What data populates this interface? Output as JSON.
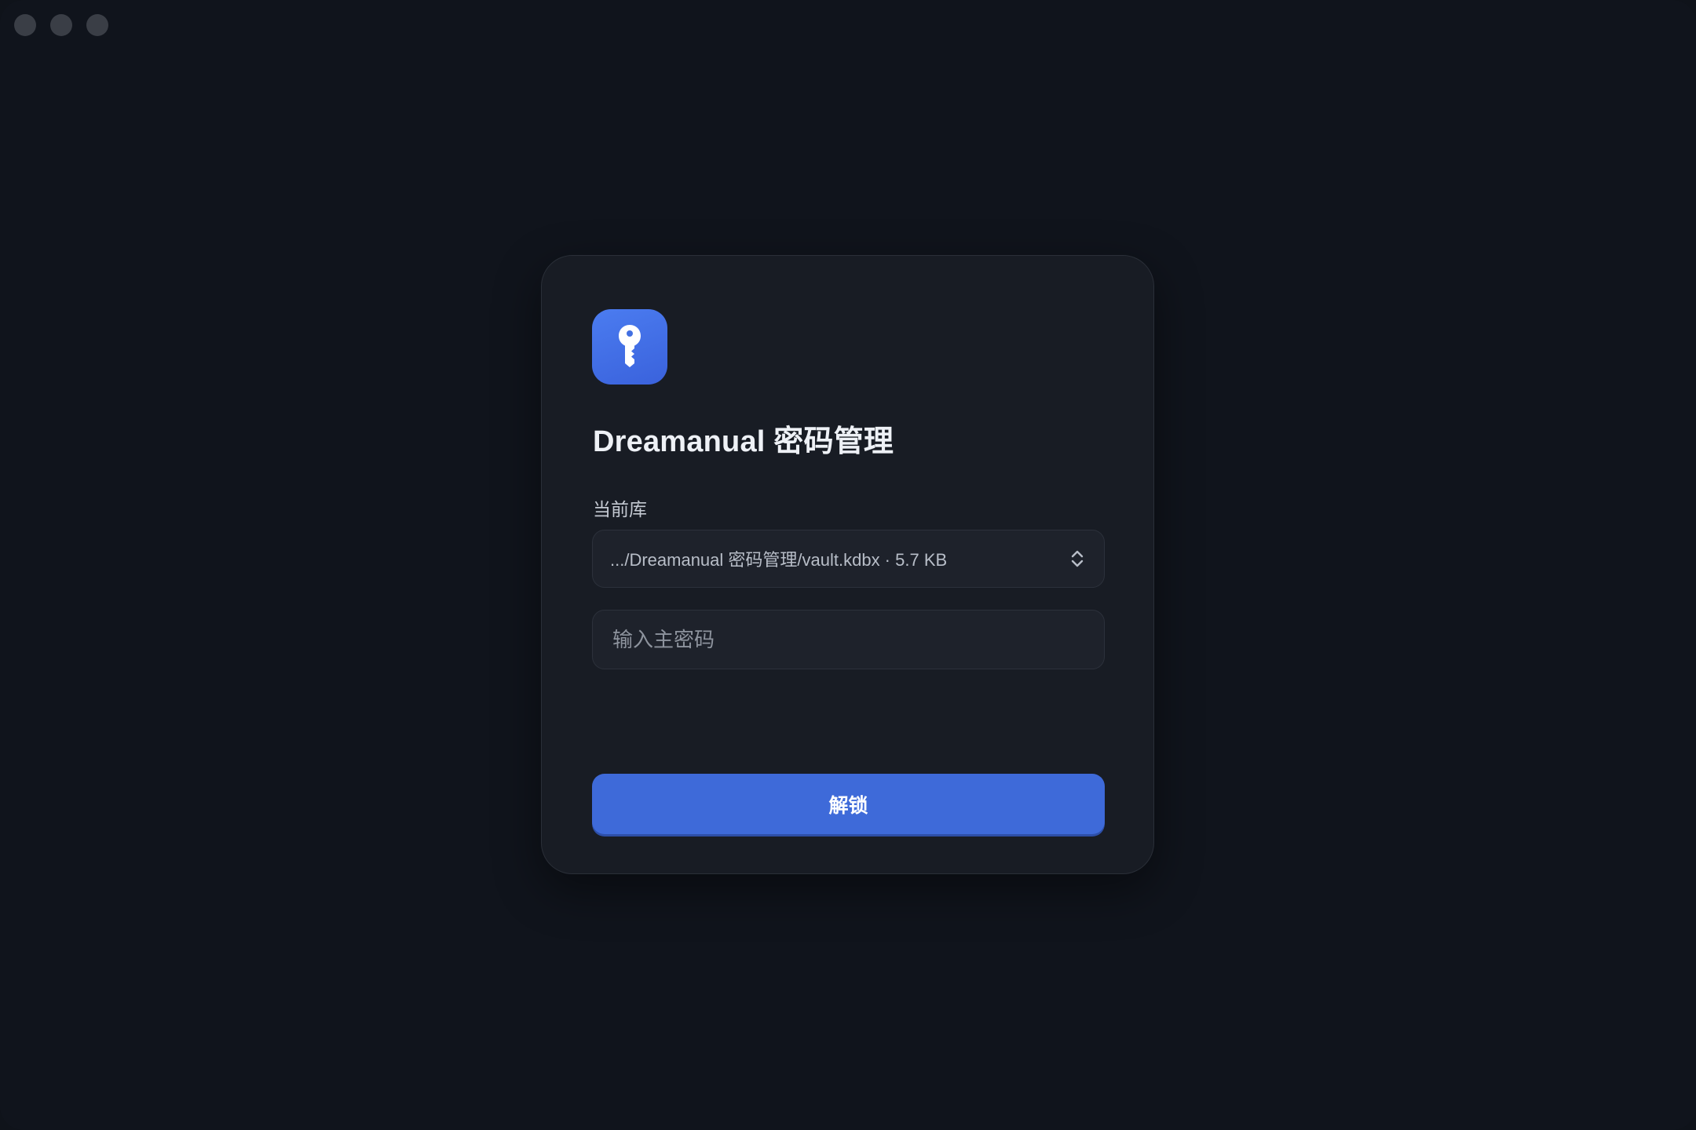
{
  "window": {
    "traffic_lights": [
      "close",
      "minimize",
      "zoom"
    ]
  },
  "app": {
    "icon": "key-icon",
    "title": "Dreamanual 密码管理"
  },
  "vault": {
    "label": "当前库",
    "selected": ".../Dreamanual 密码管理/vault.kdbx · 5.7 KB",
    "icon": "chevron-up-down-icon"
  },
  "password": {
    "placeholder": "输入主密码",
    "value": ""
  },
  "actions": {
    "unlock_label": "解锁"
  },
  "colors": {
    "accent": "#3e6ad9",
    "background": "#10141c",
    "card": "#181c24"
  }
}
